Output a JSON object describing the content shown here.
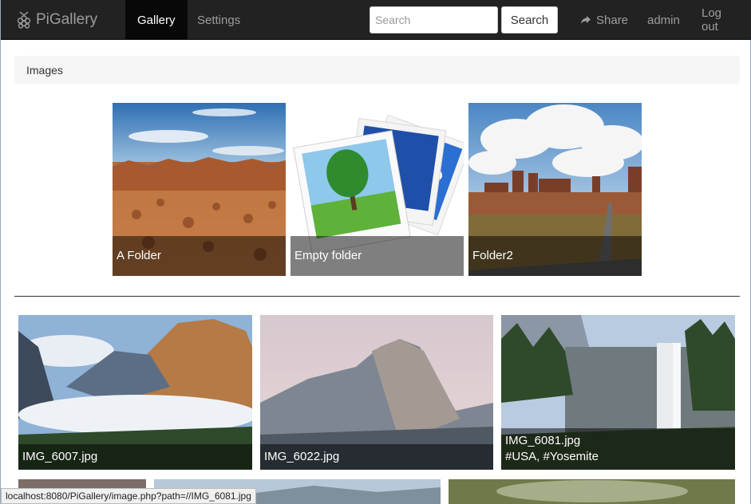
{
  "navbar": {
    "brand": "PiGallery",
    "brand_icon": "raspberry-icon",
    "links": {
      "gallery": "Gallery",
      "settings": "Settings"
    },
    "search": {
      "placeholder": "Search",
      "value": "",
      "button_label": "Search"
    },
    "share_label": "Share",
    "share_icon": "share-arrow-icon",
    "user_label": "admin",
    "logout_label": "Log out"
  },
  "breadcrumb": {
    "label": "Images"
  },
  "folders": [
    {
      "name": "A Folder",
      "thumbnail": "desert-canyon"
    },
    {
      "name": "Empty folder",
      "thumbnail": "photos-stack-icon"
    },
    {
      "name": "Folder2",
      "thumbnail": "monument-valley-road"
    }
  ],
  "photos": [
    {
      "name": "IMG_6007.jpg",
      "tags": ""
    },
    {
      "name": "IMG_6022.jpg",
      "tags": ""
    },
    {
      "name": "IMG_6081.jpg",
      "tags": "#USA, #Yosemite"
    }
  ],
  "status_bar": {
    "url": "localhost:8080/PiGallery/image.php?path=//IMG_6081.jpg"
  },
  "colors": {
    "navbar": "#222222",
    "navbar_active": "#080808",
    "navbar_text": "#9d9d9d",
    "caption_overlay": "rgba(0,0,0,0.5)"
  }
}
